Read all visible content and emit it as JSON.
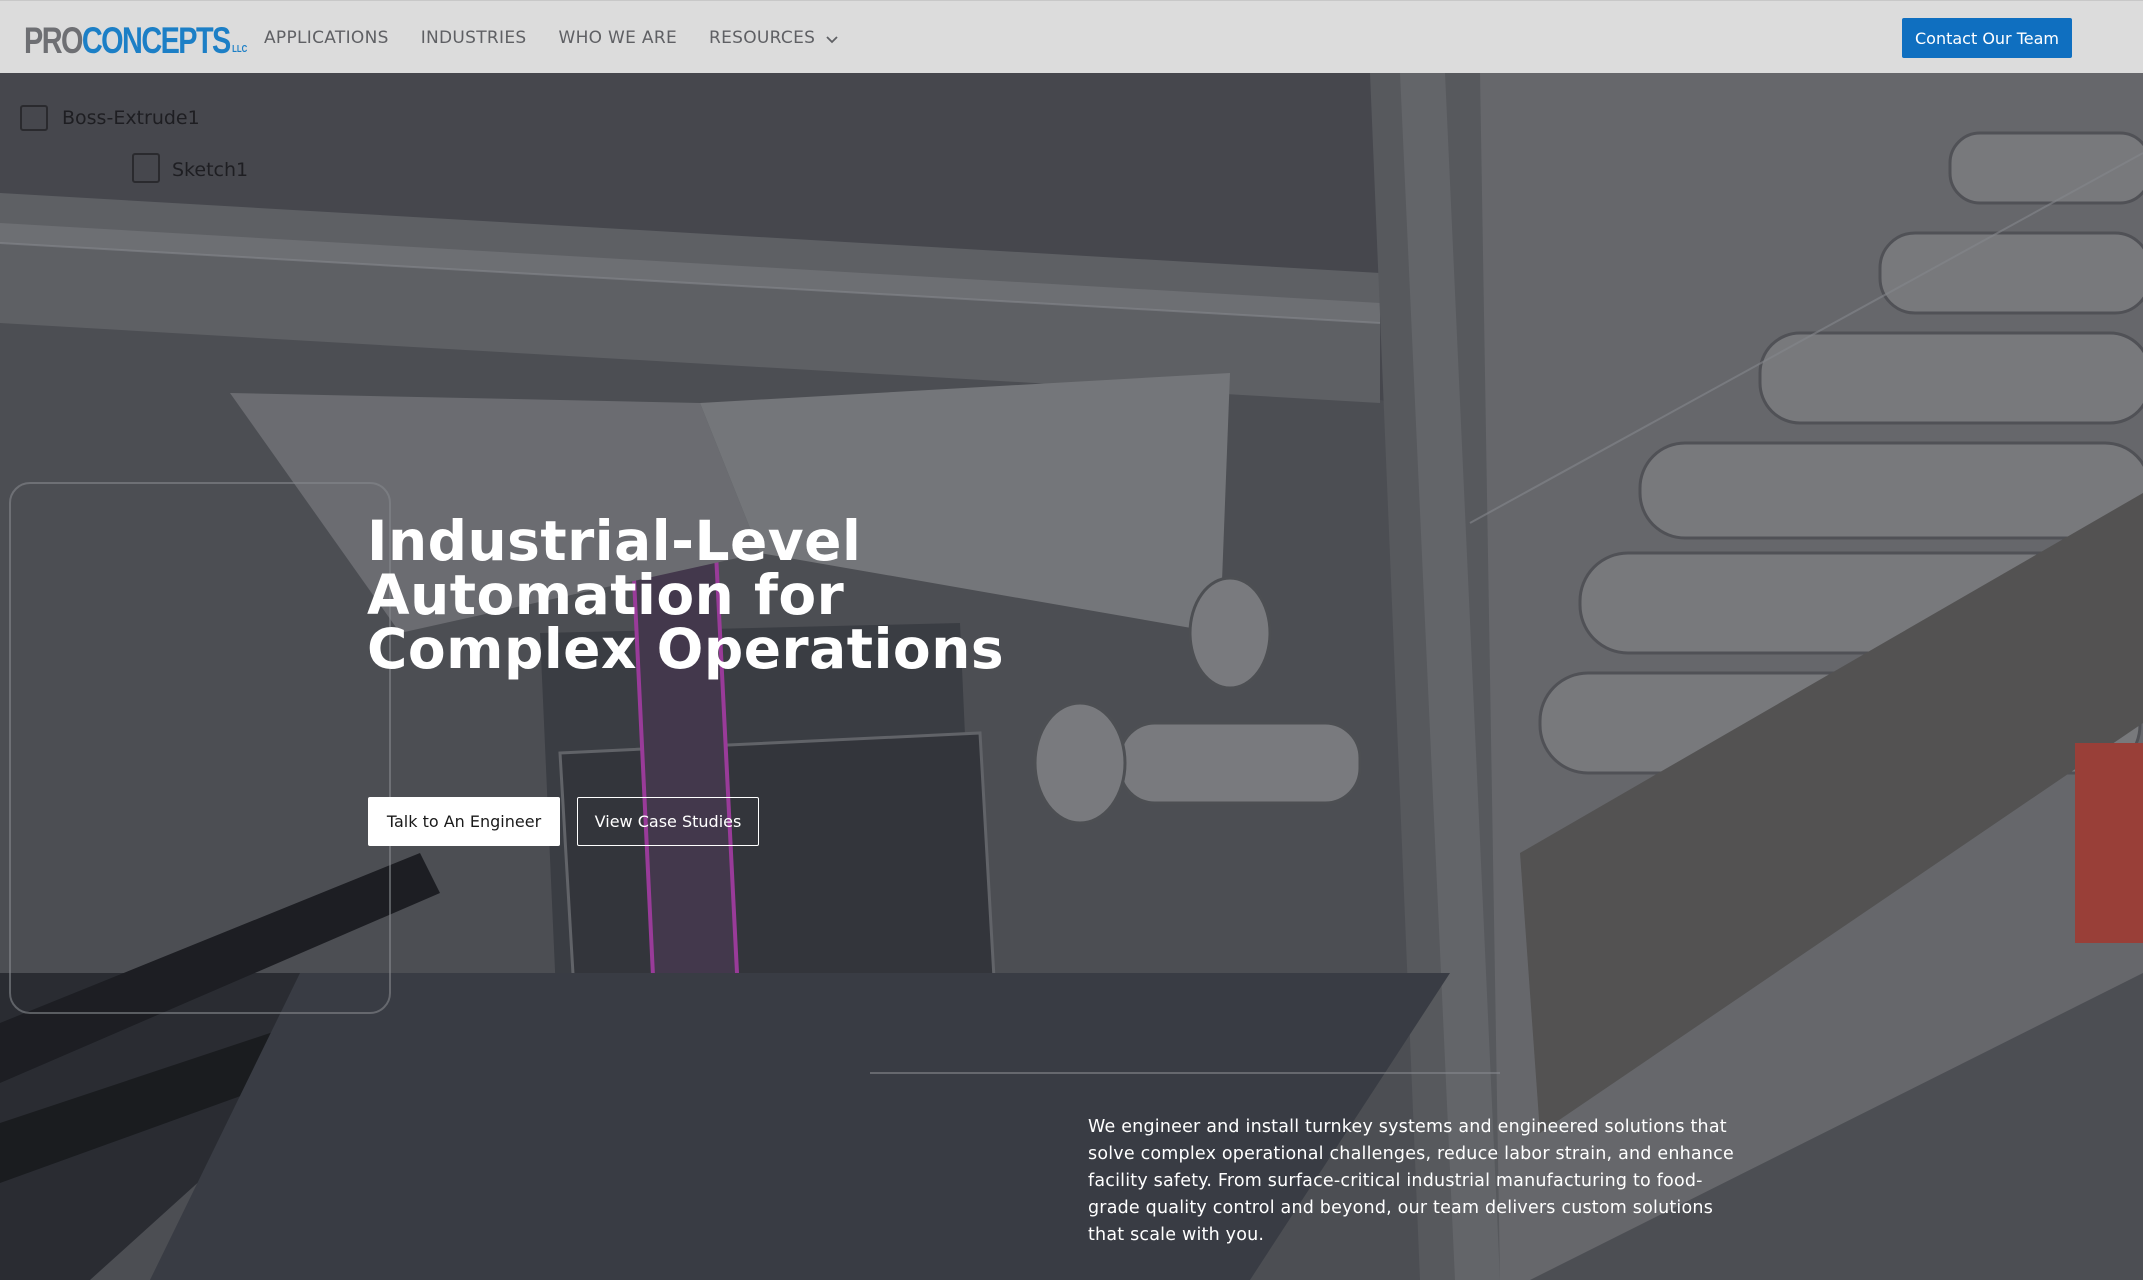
{
  "brand": {
    "logo_pro": "PRO",
    "logo_concepts": "CONCEPTS",
    "logo_llc": "LLC",
    "primary_color": "#1c7fc6",
    "secondary_color": "#6e6f73"
  },
  "nav": {
    "items": [
      {
        "label": "APPLICATIONS"
      },
      {
        "label": "INDUSTRIES"
      },
      {
        "label": "WHO WE ARE"
      },
      {
        "label": "RESOURCES",
        "icon": "chevron-down-icon"
      }
    ],
    "contact_label": "Contact Our Team",
    "contact_color": "#0f6fc0"
  },
  "hero": {
    "cad_labels": [
      "Boss-Extrude1",
      "Sketch1"
    ],
    "headline": "Industrial-Level Automation for Complex Operations",
    "primary_cta": "Talk to An Engineer",
    "secondary_cta": "View Case Studies",
    "description": "We engineer and install turnkey systems and engineered solutions that solve complex operational challenges, reduce labor strain, and enhance facility safety. From surface-critical industrial manufacturing to food-grade quality control and beyond, our team delivers custom solutions that scale with you."
  }
}
